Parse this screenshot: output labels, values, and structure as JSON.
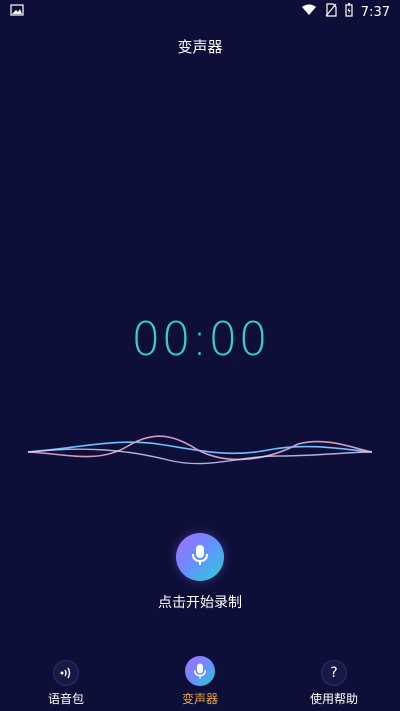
{
  "status_bar": {
    "time": "7:37"
  },
  "header": {
    "title": "变声器"
  },
  "timer": {
    "value": "00:00",
    "color": "#35d0c6"
  },
  "record": {
    "label": "点击开始录制"
  },
  "tabs": [
    {
      "label": "语音包",
      "icon": "sound-wave-icon",
      "active": false
    },
    {
      "label": "变声器",
      "icon": "microphone-icon",
      "active": true
    },
    {
      "label": "使用帮助",
      "icon": "question-icon",
      "active": false
    }
  ],
  "colors": {
    "background": "#0e0f38",
    "accent": "#f2a23f"
  }
}
